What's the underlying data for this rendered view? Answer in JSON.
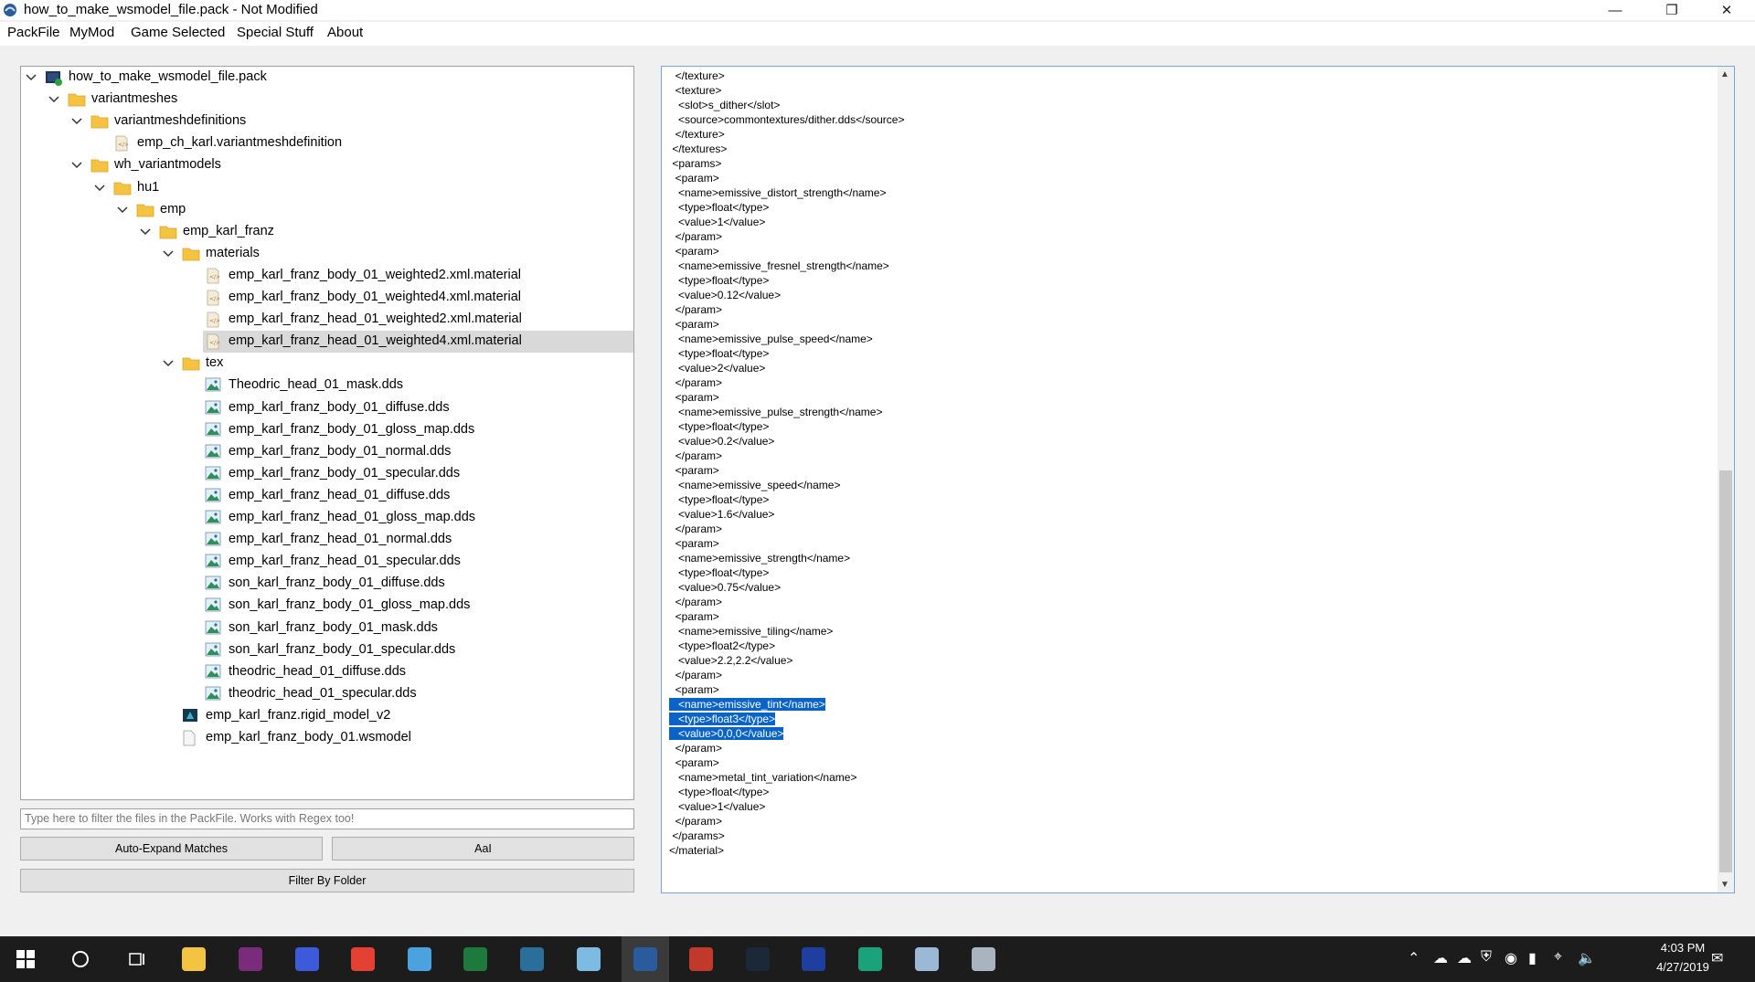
{
  "window": {
    "title": "how_to_make_wsmodel_file.pack - Not Modified"
  },
  "menu": [
    "PackFile",
    "MyMod",
    "Game Selected",
    "Special Stuff",
    "About"
  ],
  "tree": [
    {
      "label": "how_to_make_wsmodel_file.pack",
      "depth": 0,
      "expanded": true,
      "icon": "pack-icon"
    },
    {
      "label": "variantmeshes",
      "depth": 1,
      "expanded": true,
      "icon": "folder-icon"
    },
    {
      "label": "variantmeshdefinitions",
      "depth": 2,
      "expanded": true,
      "icon": "folder-icon"
    },
    {
      "label": "emp_ch_karl.variantmeshdefinition",
      "depth": 3,
      "icon": "xml-file-icon"
    },
    {
      "label": "wh_variantmodels",
      "depth": 2,
      "expanded": true,
      "icon": "folder-icon"
    },
    {
      "label": "hu1",
      "depth": 3,
      "expanded": true,
      "icon": "folder-icon"
    },
    {
      "label": "emp",
      "depth": 4,
      "expanded": true,
      "icon": "folder-icon"
    },
    {
      "label": "emp_karl_franz",
      "depth": 5,
      "expanded": true,
      "icon": "folder-icon"
    },
    {
      "label": "materials",
      "depth": 6,
      "expanded": true,
      "icon": "folder-icon"
    },
    {
      "label": "emp_karl_franz_body_01_weighted2.xml.material",
      "depth": 7,
      "icon": "xml-file-icon"
    },
    {
      "label": "emp_karl_franz_body_01_weighted4.xml.material",
      "depth": 7,
      "icon": "xml-file-icon"
    },
    {
      "label": "emp_karl_franz_head_01_weighted2.xml.material",
      "depth": 7,
      "icon": "xml-file-icon"
    },
    {
      "label": "emp_karl_franz_head_01_weighted4.xml.material",
      "depth": 7,
      "icon": "xml-file-icon",
      "selected": true
    },
    {
      "label": "tex",
      "depth": 6,
      "expanded": true,
      "icon": "folder-icon"
    },
    {
      "label": "Theodric_head_01_mask.dds",
      "depth": 7,
      "icon": "image-file-icon"
    },
    {
      "label": "emp_karl_franz_body_01_diffuse.dds",
      "depth": 7,
      "icon": "image-file-icon"
    },
    {
      "label": "emp_karl_franz_body_01_gloss_map.dds",
      "depth": 7,
      "icon": "image-file-icon"
    },
    {
      "label": "emp_karl_franz_body_01_normal.dds",
      "depth": 7,
      "icon": "image-file-icon"
    },
    {
      "label": "emp_karl_franz_body_01_specular.dds",
      "depth": 7,
      "icon": "image-file-icon"
    },
    {
      "label": "emp_karl_franz_head_01_diffuse.dds",
      "depth": 7,
      "icon": "image-file-icon"
    },
    {
      "label": "emp_karl_franz_head_01_gloss_map.dds",
      "depth": 7,
      "icon": "image-file-icon"
    },
    {
      "label": "emp_karl_franz_head_01_normal.dds",
      "depth": 7,
      "icon": "image-file-icon"
    },
    {
      "label": "emp_karl_franz_head_01_specular.dds",
      "depth": 7,
      "icon": "image-file-icon"
    },
    {
      "label": "son_karl_franz_body_01_diffuse.dds",
      "depth": 7,
      "icon": "image-file-icon"
    },
    {
      "label": "son_karl_franz_body_01_gloss_map.dds",
      "depth": 7,
      "icon": "image-file-icon"
    },
    {
      "label": "son_karl_franz_body_01_mask.dds",
      "depth": 7,
      "icon": "image-file-icon"
    },
    {
      "label": "son_karl_franz_body_01_specular.dds",
      "depth": 7,
      "icon": "image-file-icon"
    },
    {
      "label": "theodric_head_01_diffuse.dds",
      "depth": 7,
      "icon": "image-file-icon"
    },
    {
      "label": "theodric_head_01_specular.dds",
      "depth": 7,
      "icon": "image-file-icon"
    },
    {
      "label": "emp_karl_franz.rigid_model_v2",
      "depth": 6,
      "icon": "model-file-icon"
    },
    {
      "label": "emp_karl_franz_body_01.wsmodel",
      "depth": 6,
      "icon": "generic-file-icon"
    }
  ],
  "filter": {
    "placeholder": "Type here to filter the files in the PackFile. Works with Regex too!",
    "auto_expand_label": "Auto-Expand Matches",
    "case_label": "AaI",
    "filter_by_folder_label": "Filter By Folder"
  },
  "editor": {
    "lines": [
      {
        "text": "  </texture>"
      },
      {
        "text": "  <texture>"
      },
      {
        "text": "   <slot>s_dither</slot>"
      },
      {
        "text": "   <source>commontextures/dither.dds</source>"
      },
      {
        "text": "  </texture>"
      },
      {
        "text": " </textures>"
      },
      {
        "text": " <params>"
      },
      {
        "text": "  <param>"
      },
      {
        "text": "   <name>emissive_distort_strength</name>"
      },
      {
        "text": "   <type>float</type>"
      },
      {
        "text": "   <value>1</value>"
      },
      {
        "text": "  </param>"
      },
      {
        "text": "  <param>"
      },
      {
        "text": "   <name>emissive_fresnel_strength</name>"
      },
      {
        "text": "   <type>float</type>"
      },
      {
        "text": "   <value>0.12</value>"
      },
      {
        "text": "  </param>"
      },
      {
        "text": "  <param>"
      },
      {
        "text": "   <name>emissive_pulse_speed</name>"
      },
      {
        "text": "   <type>float</type>"
      },
      {
        "text": "   <value>2</value>"
      },
      {
        "text": "  </param>"
      },
      {
        "text": "  <param>"
      },
      {
        "text": "   <name>emissive_pulse_strength</name>"
      },
      {
        "text": "   <type>float</type>"
      },
      {
        "text": "   <value>0.2</value>"
      },
      {
        "text": "  </param>"
      },
      {
        "text": "  <param>"
      },
      {
        "text": "   <name>emissive_speed</name>"
      },
      {
        "text": "   <type>float</type>"
      },
      {
        "text": "   <value>1.6</value>"
      },
      {
        "text": "  </param>"
      },
      {
        "text": "  <param>"
      },
      {
        "text": "   <name>emissive_strength</name>"
      },
      {
        "text": "   <type>float</type>"
      },
      {
        "text": "   <value>0.75</value>"
      },
      {
        "text": "  </param>"
      },
      {
        "text": "  <param>"
      },
      {
        "text": "   <name>emissive_tiling</name>"
      },
      {
        "text": "   <type>float2</type>"
      },
      {
        "text": "   <value>2.2,2.2</value>"
      },
      {
        "text": "  </param>"
      },
      {
        "text": "  <param>"
      },
      {
        "text": "   <name>emissive_tint</name>",
        "highlight": true
      },
      {
        "text": "   <type>float3</type>",
        "highlight": true
      },
      {
        "text": "   <value>0,0,0</value>",
        "highlight": true
      },
      {
        "text": "  </param>"
      },
      {
        "text": "  <param>"
      },
      {
        "text": "   <name>metal_tint_variation</name>"
      },
      {
        "text": "   <type>float</type>"
      },
      {
        "text": "   <value>1</value>"
      },
      {
        "text": "  </param>"
      },
      {
        "text": " </params>"
      },
      {
        "text": "</material>"
      }
    ]
  },
  "taskbar": {
    "apps": [
      "start-icon",
      "cortana-icon",
      "task-view-icon",
      "file-explorer-icon",
      "app-icon",
      "app-8-icon",
      "chrome-icon",
      "network-app-icon",
      "excel-icon",
      "app-icon",
      "notepad-icon",
      "rpfm-icon",
      "app-icon",
      "steam-icon",
      "unreal-icon",
      "app-icon",
      "paint-icon",
      "app-icon"
    ],
    "time": "4:03 PM",
    "date": "4/27/2019"
  },
  "colors": {
    "selection": "#0a64c8",
    "folder": "#f5c342",
    "taskbar": "#1c1c1c"
  }
}
